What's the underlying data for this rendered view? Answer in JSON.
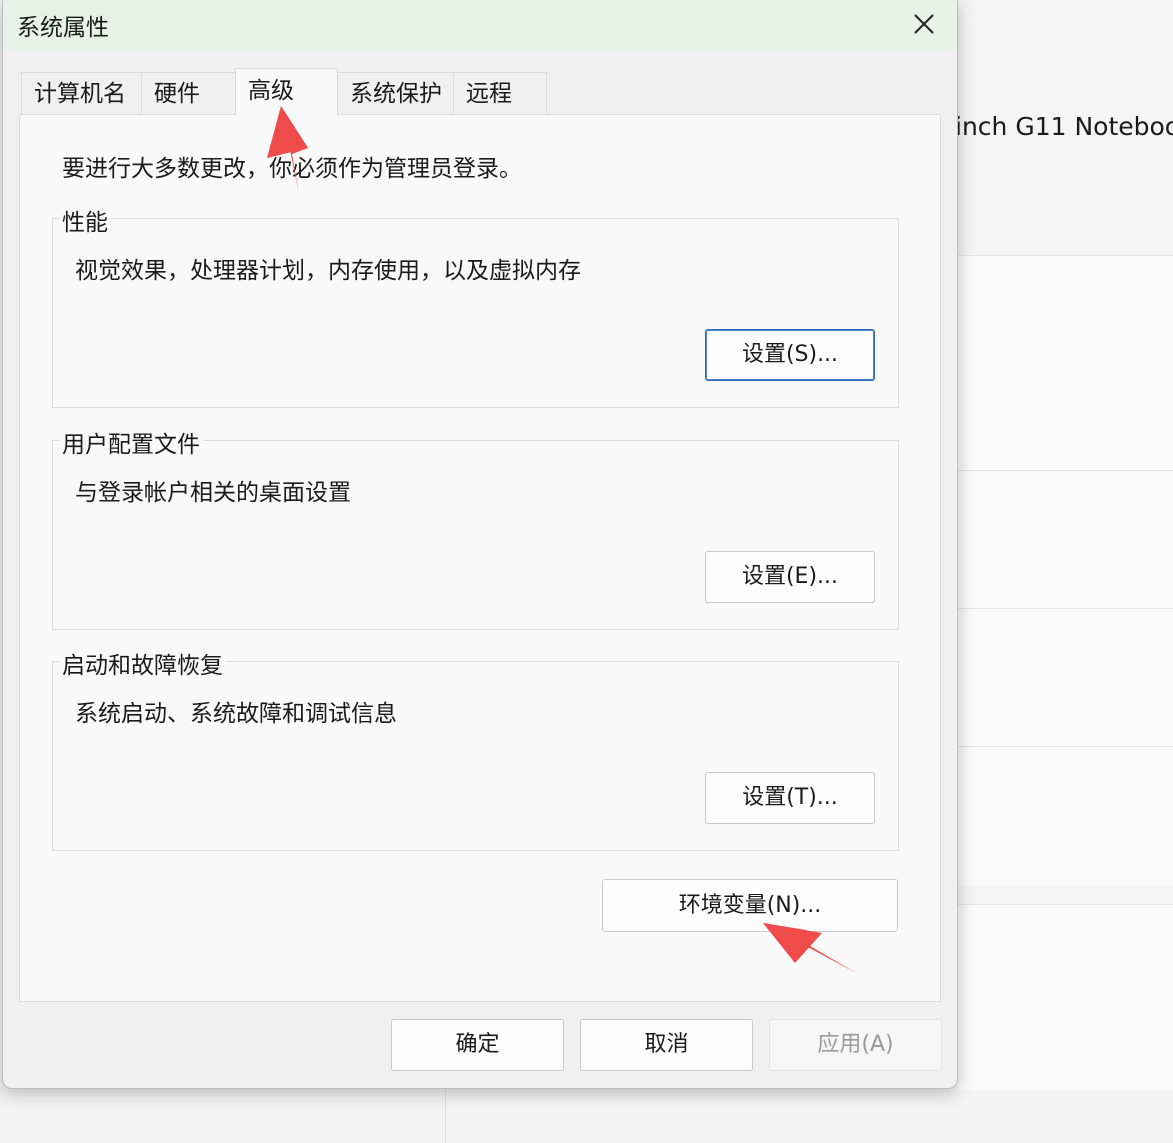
{
  "background": {
    "window_title_fragment": "inch G11 Notebook"
  },
  "dialog": {
    "title": "系统属性",
    "tabs": [
      {
        "label": "计算机名"
      },
      {
        "label": "硬件"
      },
      {
        "label": "高级"
      },
      {
        "label": "系统保护"
      },
      {
        "label": "远程"
      }
    ],
    "admin_note": "要进行大多数更改，你必须作为管理员登录。",
    "groups": [
      {
        "legend": "性能",
        "description": "视觉效果，处理器计划，内存使用，以及虚拟内存",
        "button": "设置(S)..."
      },
      {
        "legend": "用户配置文件",
        "description": "与登录帐户相关的桌面设置",
        "button": "设置(E)..."
      },
      {
        "legend": "启动和故障恢复",
        "description": "系统启动、系统故障和调试信息",
        "button": "设置(T)..."
      }
    ],
    "env_button": "环境变量(N)...",
    "ok": "确定",
    "cancel": "取消",
    "apply": "应用(A)"
  },
  "colors": {
    "title_bg": "#e6f2e6",
    "annotation_arrow": "#f04b4b",
    "focus_border": "#2f67b8"
  }
}
